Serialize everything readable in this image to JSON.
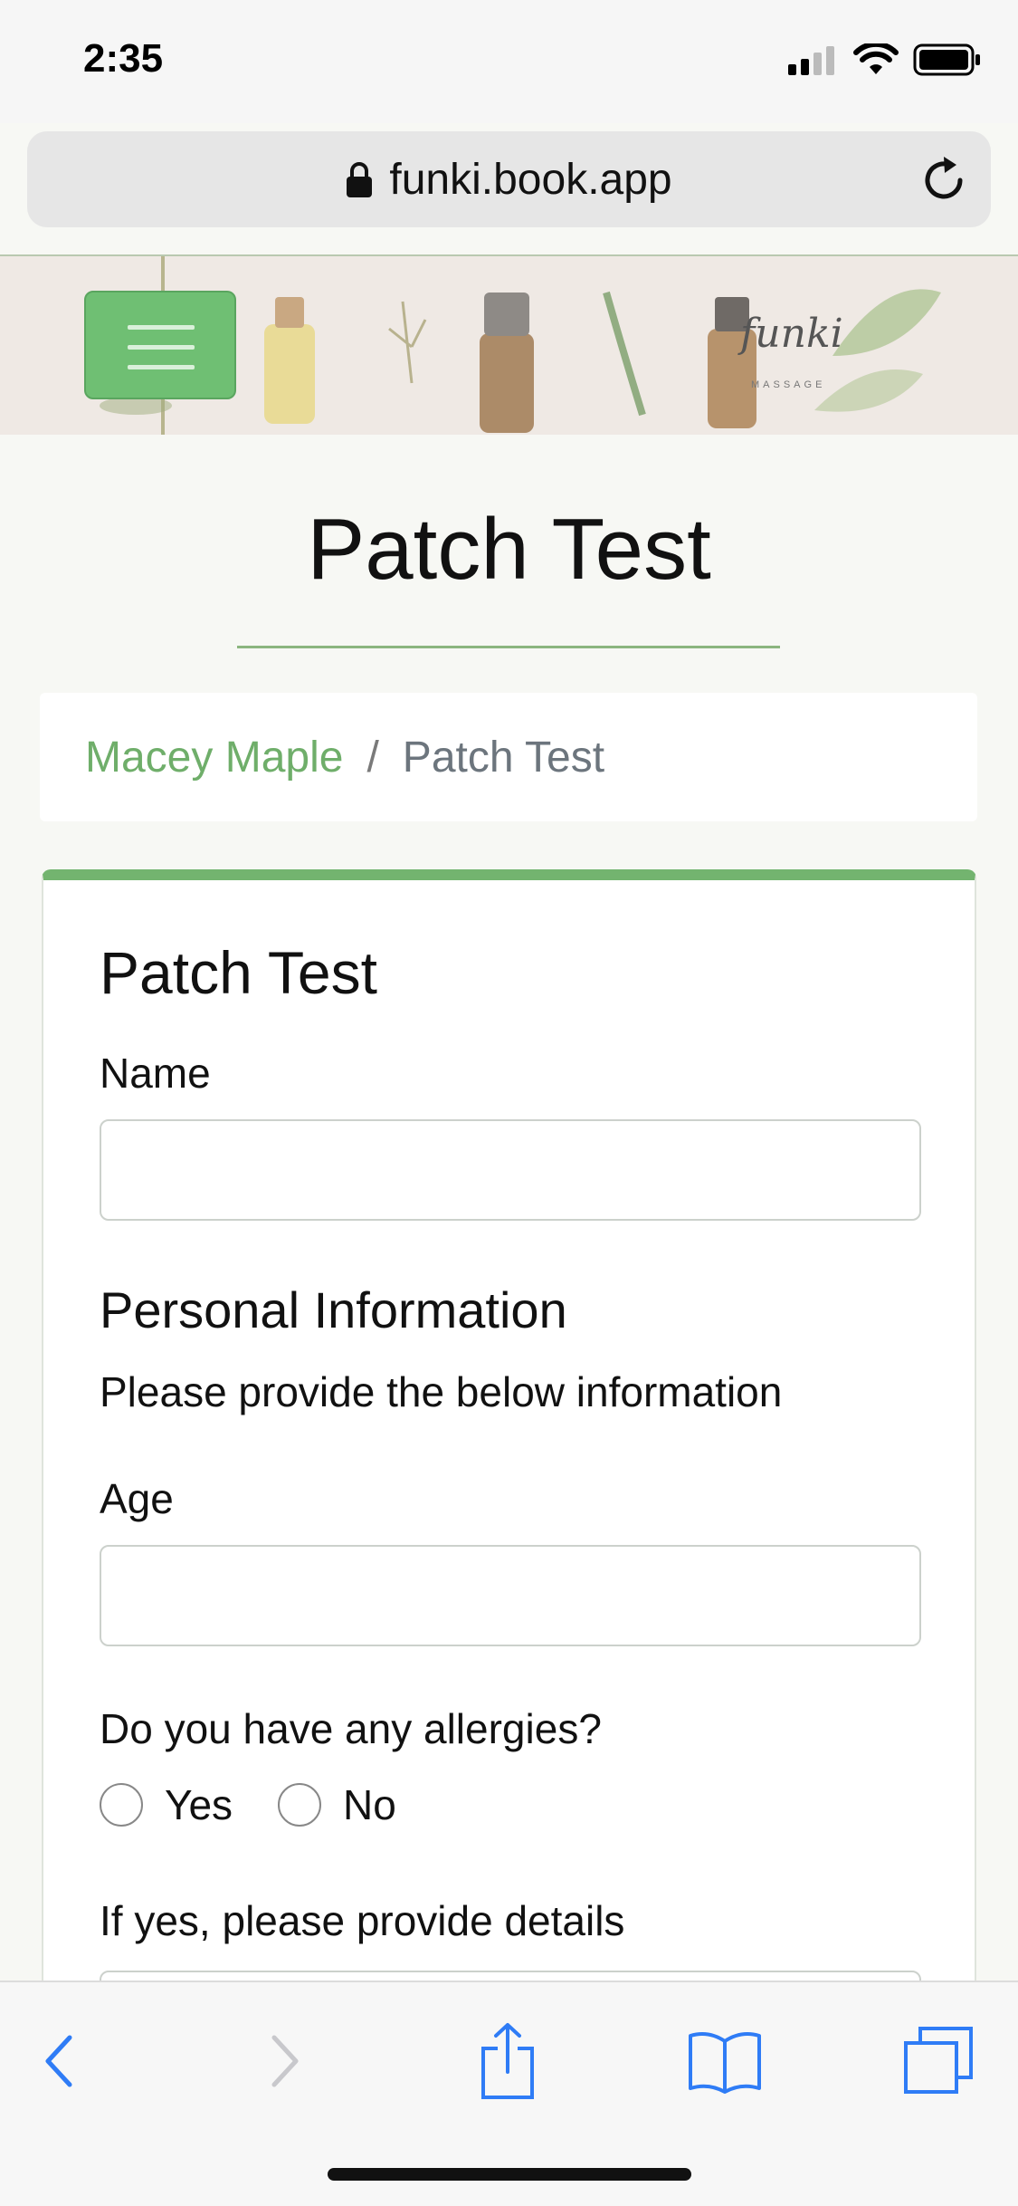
{
  "status_bar": {
    "time": "2:35"
  },
  "browser": {
    "url": "funki.book.app"
  },
  "banner": {
    "logo_text": "funki",
    "logo_subtext": "MASSAGE"
  },
  "page": {
    "title": "Patch Test"
  },
  "breadcrumb": {
    "parent": "Macey Maple",
    "separator": "/",
    "current": "Patch Test"
  },
  "form": {
    "title": "Patch Test",
    "name_label": "Name",
    "name_value": "",
    "personal_section_title": "Personal Information",
    "personal_section_desc": "Please provide the below information",
    "age_label": "Age",
    "age_value": "",
    "allergies_question": "Do you have any allergies?",
    "allergy_options": [
      "Yes",
      "No"
    ],
    "allergy_details_label": "If yes, please provide details"
  },
  "colors": {
    "accent": "#73b46f",
    "menu_button": "#6fbf73",
    "link": "#6fae6a",
    "ios_blue": "#2f7cf6"
  }
}
